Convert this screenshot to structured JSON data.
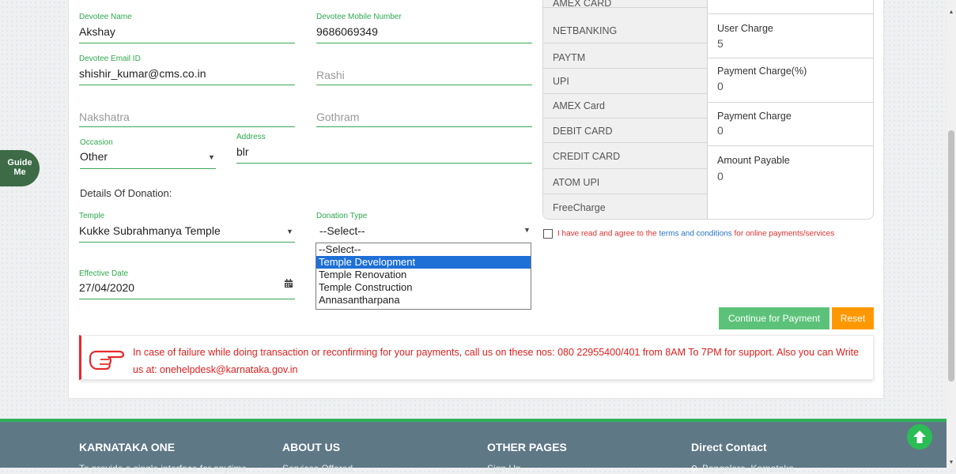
{
  "form": {
    "devotee_name": {
      "label": "Devotee Name",
      "value": "Akshay"
    },
    "devotee_mobile": {
      "label": "Devotee Mobile Number",
      "value": "9686069349"
    },
    "devotee_email": {
      "label": "Devotee Email ID",
      "value": "shishir_kumar@cms.co.in"
    },
    "rashi": {
      "placeholder": "Rashi"
    },
    "nakshatra": {
      "placeholder": "Nakshatra"
    },
    "gothram": {
      "placeholder": "Gothram"
    },
    "occasion": {
      "label": "Occasion",
      "value": "Other"
    },
    "address": {
      "label": "Address",
      "value": "blr"
    },
    "donation_title": "Details Of Donation:",
    "temple": {
      "label": "Temple",
      "value": "Kukke Subrahmanya Temple"
    },
    "donation_type": {
      "label": "Donation Type",
      "value": "--Select--",
      "options": [
        "--Select--",
        "Temple Development",
        "Temple Renovation",
        "Temple Construction",
        "Annasantharpana"
      ],
      "highlighted": "Temple Development"
    },
    "effective_date": {
      "label": "Effective Date",
      "value": "27/04/2020"
    }
  },
  "payment_methods": [
    "AMEX CARD",
    "NETBANKING",
    "PAYTM",
    "UPI",
    "AMEX Card",
    "DEBIT CARD",
    "CREDIT CARD",
    "ATOM UPI",
    "FreeCharge"
  ],
  "charges": {
    "user_charge": {
      "label": "User Charge",
      "value": "5"
    },
    "payment_charge_pct": {
      "label": "Payment Charge(%)",
      "value": "0"
    },
    "payment_charge": {
      "label": "Payment Charge",
      "value": "0"
    },
    "amount_payable": {
      "label": "Amount Payable",
      "value": "0"
    }
  },
  "agreement": {
    "pre": "I have read and agree to the ",
    "link": "terms and conditions",
    "post": " for online payments/services"
  },
  "buttons": {
    "continue": "Continue for Payment",
    "reset": "Reset"
  },
  "notice": "In case of failure while doing transaction or reconfirming for your payments, call us on these nos: 080 22955400/401 from 8AM To 7PM for support. Also you can Write us at: onehelpdesk@karnataka.gov.in",
  "guide": {
    "line1": "Guide",
    "line2": "Me"
  },
  "footer": {
    "col1": {
      "title": "KARNATAKA ONE",
      "text": "To provide a single interface for anytime"
    },
    "col2": {
      "title": "ABOUT US",
      "text": "Services Offered"
    },
    "col3": {
      "title": "OTHER PAGES",
      "text": "Sign Up"
    },
    "col4": {
      "title": "Direct Contact",
      "text": "Bangalore, Karnataka"
    }
  },
  "colors": {
    "accent_green": "#3aa657",
    "warning_red": "#e02020",
    "continue_green": "#5cc27a",
    "reset_orange": "#ff9800",
    "footer_bg": "#5e7886"
  }
}
